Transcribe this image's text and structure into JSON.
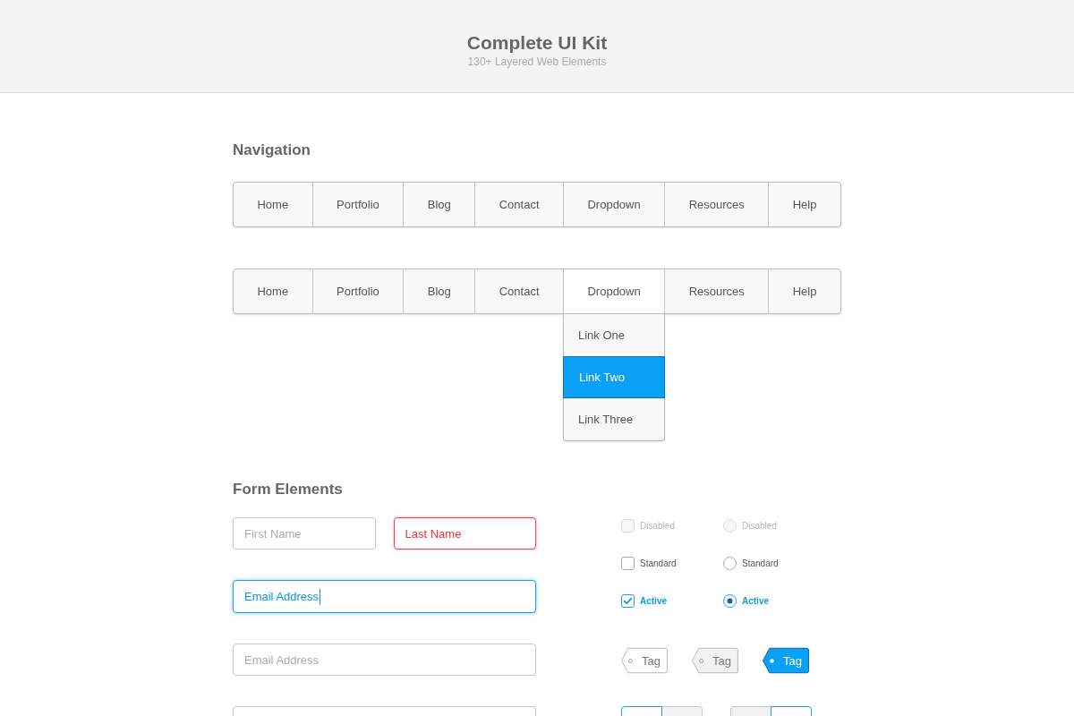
{
  "header": {
    "title": "Complete UI Kit",
    "subtitle": "130+ Layered Web Elements"
  },
  "navigation": {
    "heading": "Navigation",
    "bars": [
      {
        "items": [
          {
            "label": "Home"
          },
          {
            "label": "Portfolio"
          },
          {
            "label": "Blog"
          },
          {
            "label": "Contact"
          },
          {
            "label": "Dropdown"
          },
          {
            "label": "Resources"
          },
          {
            "label": "Help"
          }
        ]
      },
      {
        "items": [
          {
            "label": "Home"
          },
          {
            "label": "Portfolio"
          },
          {
            "label": "Blog"
          },
          {
            "label": "Contact"
          },
          {
            "label": "Dropdown",
            "menu": [
              {
                "label": "Link One",
                "selected": false
              },
              {
                "label": "Link Two",
                "selected": true
              },
              {
                "label": "Link Three",
                "selected": false
              }
            ]
          },
          {
            "label": "Resources"
          },
          {
            "label": "Help"
          }
        ]
      }
    ]
  },
  "form": {
    "heading": "Form Elements",
    "field_rows": [
      [
        {
          "error": false,
          "focused": false,
          "placeholder": "First Name"
        },
        {
          "error": true,
          "focused": false,
          "placeholder": "Last Name"
        }
      ],
      [
        {
          "error": false,
          "focused": true,
          "value": "Email Address"
        }
      ],
      [
        {
          "error": false,
          "focused": false,
          "placeholder": "Email Address"
        }
      ],
      [
        {
          "error": false,
          "focused": false
        }
      ]
    ],
    "checkboxes": [
      {
        "label": "Disabled",
        "checked": false,
        "disabled": true
      },
      {
        "label": "Standard",
        "checked": false,
        "disabled": false
      },
      {
        "label": "Active",
        "checked": true,
        "disabled": false
      }
    ],
    "radios": [
      {
        "label": "Disabled",
        "selected": false,
        "disabled": true
      },
      {
        "label": "Standard",
        "selected": false,
        "disabled": false
      },
      {
        "label": "Active",
        "selected": true,
        "disabled": false
      }
    ],
    "tags": [
      {
        "label": "Tag",
        "kind": "outline"
      },
      {
        "label": "Tag",
        "kind": "muted"
      },
      {
        "label": "Tag",
        "kind": "active"
      }
    ],
    "segmented_controls": [
      {
        "segments": [
          {
            "selected": true
          },
          {
            "selected": false
          }
        ]
      },
      {
        "segments": [
          {
            "selected": false
          },
          {
            "selected": true
          }
        ]
      }
    ]
  }
}
